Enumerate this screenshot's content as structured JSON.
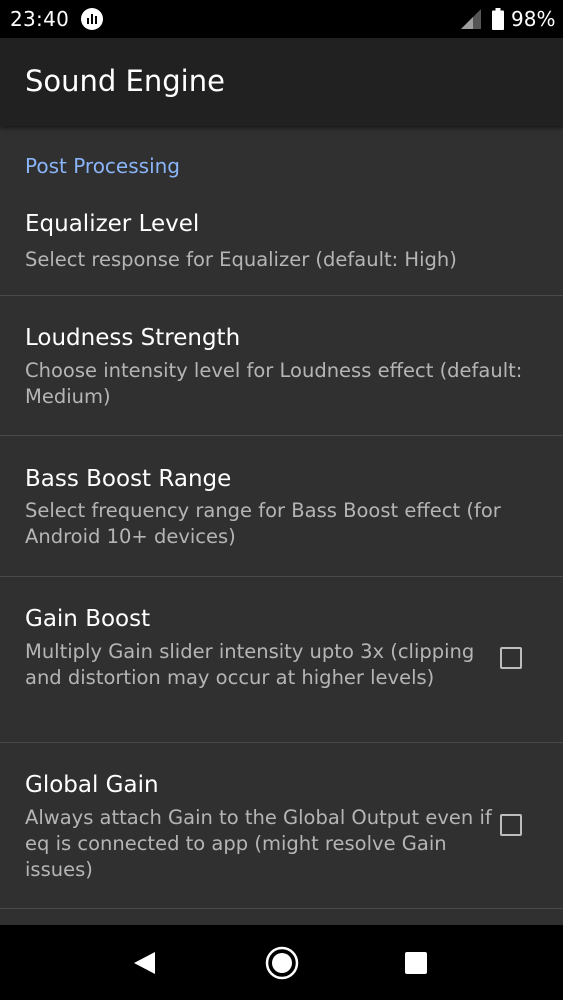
{
  "status_bar": {
    "time": "23:40",
    "battery": "98%"
  },
  "app_bar": {
    "title": "Sound Engine"
  },
  "section": {
    "header": "Post Processing"
  },
  "preferences": [
    {
      "title": "Equalizer Level",
      "summary": "Select response for Equalizer (default: High)"
    },
    {
      "title": "Loudness Strength",
      "summary": "Choose intensity level for Loudness effect (default: Medium)"
    },
    {
      "title": "Bass Boost Range",
      "summary": "Select frequency range for Bass Boost effect (for Android 10+ devices)"
    },
    {
      "title": "Gain Boost",
      "summary": "Multiply Gain slider intensity upto 3x (clipping and distortion may occur at higher levels)",
      "checked": false
    },
    {
      "title": "Global Gain",
      "summary": "Always attach Gain to the Global Output even if eq is connected to app (might resolve Gain issues)",
      "checked": false
    }
  ],
  "colors": {
    "accent": "#8ab4f8",
    "background": "#303030",
    "app_bar": "#212121"
  },
  "icons": {
    "status_app": "equalizer-bars-icon",
    "signal": "cell-signal-icon",
    "battery": "battery-icon",
    "nav_back": "back-triangle-icon",
    "nav_home": "home-circle-icon",
    "nav_recents": "recents-square-icon"
  }
}
